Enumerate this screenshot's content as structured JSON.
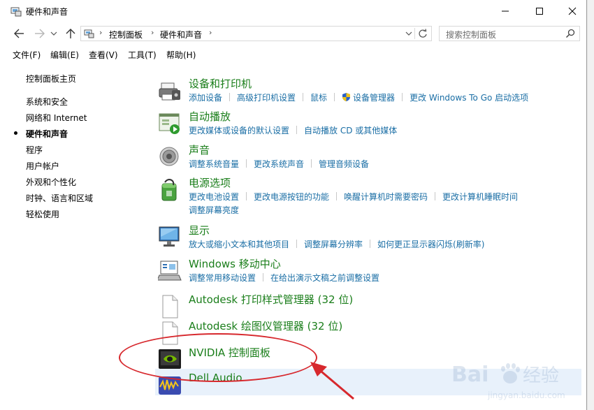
{
  "window": {
    "title": "硬件和声音"
  },
  "nav": {
    "breadcrumbs": [
      "控制面板",
      "硬件和声音"
    ],
    "search_placeholder": "搜索控制面板"
  },
  "menu": [
    "文件(F)",
    "编辑(E)",
    "查看(V)",
    "工具(T)",
    "帮助(H)"
  ],
  "sidebar": {
    "items": [
      {
        "label": "控制面板主页"
      },
      {
        "label": "系统和安全"
      },
      {
        "label": "网络和 Internet"
      },
      {
        "label": "硬件和声音",
        "active": true
      },
      {
        "label": "程序"
      },
      {
        "label": "用户帐户"
      },
      {
        "label": "外观和个性化"
      },
      {
        "label": "时钟、语言和区域"
      },
      {
        "label": "轻松使用"
      }
    ]
  },
  "categories": [
    {
      "title": "设备和打印机",
      "icon": "printer-icon",
      "links": [
        "添加设备",
        "高级打印机设置",
        "鼠标",
        "设备管理器",
        "更改 Windows To Go 启动选项"
      ]
    },
    {
      "title": "自动播放",
      "icon": "autoplay-icon",
      "links": [
        "更改媒体或设备的默认设置",
        "自动播放 CD 或其他媒体"
      ]
    },
    {
      "title": "声音",
      "icon": "speaker-icon",
      "links": [
        "调整系统音量",
        "更改系统声音",
        "管理音频设备"
      ]
    },
    {
      "title": "电源选项",
      "icon": "power-icon",
      "links": [
        "更改电池设置",
        "更改电源按钮的功能",
        "唤醒计算机时需要密码",
        "更改计算机睡眠时间"
      ],
      "links2": [
        "调整屏幕亮度"
      ]
    },
    {
      "title": "显示",
      "icon": "monitor-icon",
      "links": [
        "放大或缩小文本和其他项目",
        "调整屏幕分辨率",
        "如何更正显示器闪烁(刷新率)"
      ]
    },
    {
      "title": "Windows 移动中心",
      "icon": "mobility-center-icon",
      "links": [
        "调整常用移动设置",
        "在给出演示文稿之前调整设置"
      ]
    },
    {
      "title": "Autodesk 打印样式管理器 (32 位)",
      "icon": "document-icon",
      "links": []
    },
    {
      "title": "Autodesk 绘图仪管理器 (32 位)",
      "icon": "document-icon",
      "links": []
    },
    {
      "title": "NVIDIA 控制面板",
      "icon": "nvidia-icon",
      "links": []
    },
    {
      "title": "Dell Audio",
      "icon": "dell-audio-icon",
      "links": []
    }
  ],
  "watermark": {
    "brand": "Bai",
    "brand2": "经验",
    "url": "jingyan.baidu.com"
  },
  "colors": {
    "title_green": "#1a7e1a",
    "link_blue": "#1a6ea5",
    "annotation_red": "#d7282d"
  }
}
